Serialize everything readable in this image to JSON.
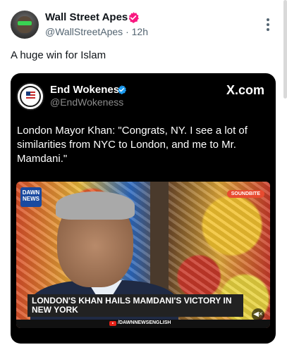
{
  "post": {
    "author_name": "Wall Street Apes",
    "handle": "@WallStreetApes",
    "separator": "·",
    "time": "12h",
    "text": "A huge win for Islam",
    "verified_color": "#f91880"
  },
  "quoted": {
    "author_name": "End Wokeness",
    "handle": "@EndWokeness",
    "brand": "X.com",
    "text": "London Mayor Khan: \"Congrats, NY. I see a lot of similarities from NYC to London, and me to Mr. Mamdani.\"",
    "verified_color": "#1d9bf0"
  },
  "video": {
    "channel_logo": "DAWN NEWS",
    "tag": "SOUNDBITE",
    "headline": "LONDON'S KHAN HAILS MAMDANI'S VICTORY IN NEW YORK",
    "source": "/DAWNNEWSENGLISH",
    "mute_icon": "speaker-muted-icon"
  }
}
